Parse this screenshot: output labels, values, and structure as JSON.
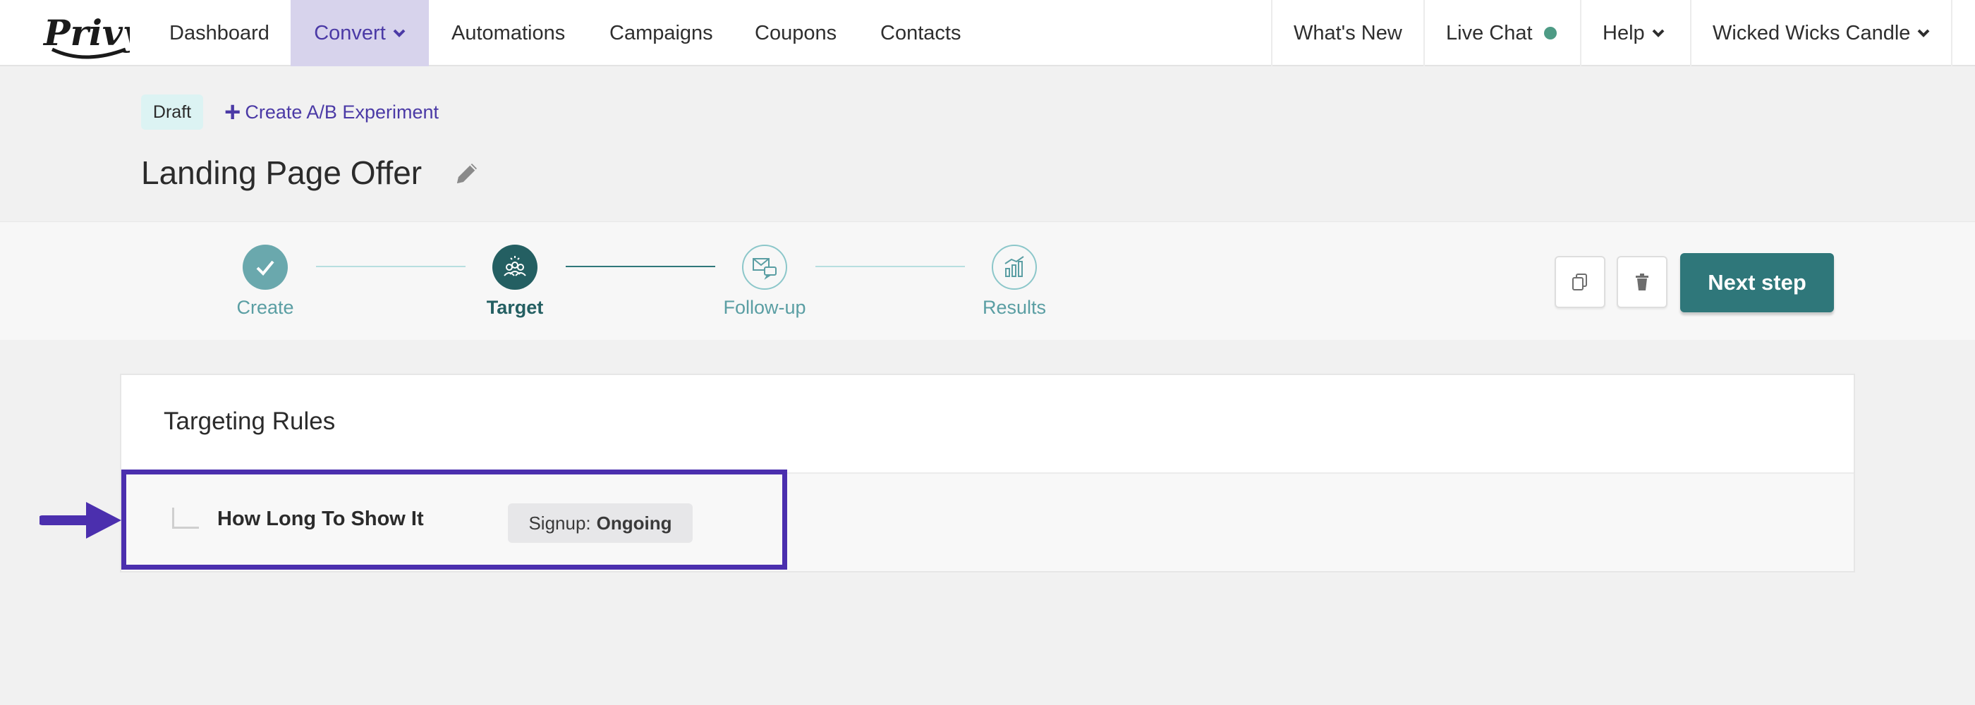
{
  "nav": {
    "logo_text": "Privy",
    "items": [
      "Dashboard",
      "Convert",
      "Automations",
      "Campaigns",
      "Coupons",
      "Contacts"
    ],
    "right": {
      "whats_new": "What's New",
      "live_chat": "Live Chat",
      "help": "Help",
      "account": "Wicked Wicks Candle"
    },
    "active_color": "#d7d3ec",
    "chat_status_color": "#4e9b85"
  },
  "header": {
    "status_badge": "Draft",
    "ab_plus": "+",
    "ab_link": "Create A/B Experiment",
    "title": "Landing Page Offer"
  },
  "stepper": {
    "steps": [
      {
        "label": "Create",
        "state": "complete",
        "icon": "check-icon"
      },
      {
        "label": "Target",
        "state": "current",
        "icon": "audience-icon"
      },
      {
        "label": "Follow-up",
        "state": "upcoming",
        "icon": "mail-chat-icon"
      },
      {
        "label": "Results",
        "state": "upcoming",
        "icon": "bar-chart-icon"
      }
    ],
    "next_label": "Next step",
    "accent": "#2f777a"
  },
  "targeting": {
    "title": "Targeting Rules",
    "rules": [
      {
        "name": "How Long To Show It",
        "chip_key": "Signup:",
        "chip_value": "Ongoing"
      }
    ]
  },
  "annotation_color": "#4b2fae"
}
